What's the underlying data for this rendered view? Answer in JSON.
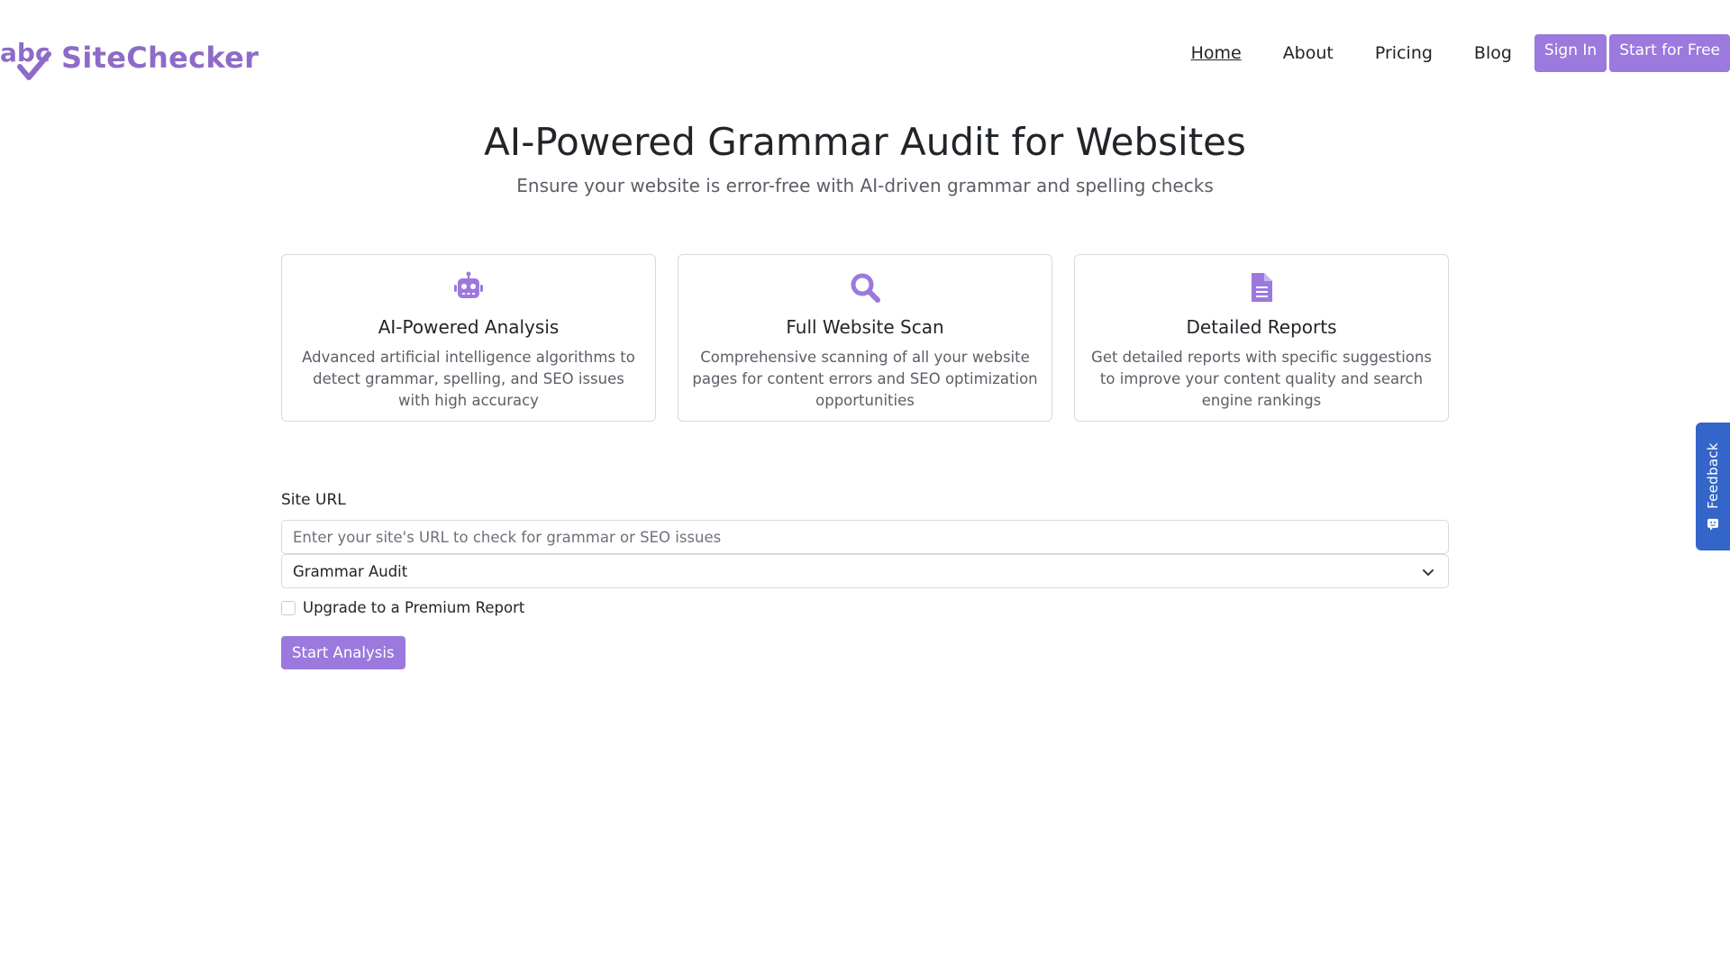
{
  "brand": {
    "logo_icon": "abc-check-logo",
    "name": "SiteChecker"
  },
  "nav": {
    "links": [
      {
        "label": "Home",
        "active": true
      },
      {
        "label": "About",
        "active": false
      },
      {
        "label": "Pricing",
        "active": false
      },
      {
        "label": "Blog",
        "active": false
      }
    ],
    "sign_in": "Sign In",
    "start_free": "Start for Free"
  },
  "hero": {
    "title": "AI-Powered Grammar Audit for Websites",
    "subtitle": "Ensure your website is error-free with AI-driven grammar and spelling checks"
  },
  "features": [
    {
      "icon": "robot-icon",
      "title": "AI-Powered Analysis",
      "text": "Advanced artificial intelligence algorithms to detect grammar, spelling, and SEO issues with high accuracy"
    },
    {
      "icon": "search-icon",
      "title": "Full Website Scan",
      "text": "Comprehensive scanning of all your website pages for content errors and SEO optimization opportunities"
    },
    {
      "icon": "document-icon",
      "title": "Detailed Reports",
      "text": "Get detailed reports with specific suggestions to improve your content quality and search engine rankings"
    }
  ],
  "form": {
    "url_label": "Site URL",
    "url_placeholder": "Enter your site's URL to check for grammar or SEO issues",
    "url_value": "",
    "audit_select_value": "Grammar Audit",
    "premium_checkbox_label": "Upgrade to a Premium Report",
    "premium_checked": false,
    "submit_label": "Start Analysis"
  },
  "feedback": {
    "label": "Feedback",
    "icon": "feedback-icon"
  },
  "colors": {
    "brand": "#8e6bc8",
    "button": "#9b79dd",
    "feedback_tab": "#3465c8"
  }
}
